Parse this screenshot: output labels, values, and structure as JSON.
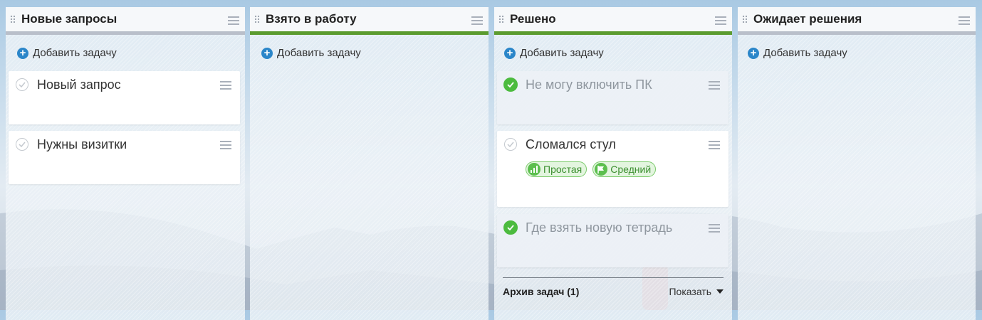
{
  "columns": [
    {
      "title": "Новые запросы",
      "add_label": "Добавить задачу",
      "bar_color": "#b9bfca",
      "cards": [
        {
          "title": "Новый запрос",
          "done": false
        },
        {
          "title": "Нужны визитки",
          "done": false
        }
      ]
    },
    {
      "title": "Взято в работу",
      "add_label": "Добавить задачу",
      "bar_color": "#5b9b2f",
      "cards": []
    },
    {
      "title": "Решено",
      "add_label": "Добавить задачу",
      "bar_color": "#5b9b2f",
      "cards": [
        {
          "title": "Не могу включить ПК",
          "done": true
        },
        {
          "title": "Сломался стул",
          "done": false,
          "tags": [
            {
              "label": "Простая",
              "icon": "bars-icon"
            },
            {
              "label": "Средний",
              "icon": "flag-icon"
            }
          ]
        },
        {
          "title": "Где взять новую тетрадь",
          "done": true
        }
      ],
      "archive": {
        "label": "Архив задач (1)",
        "show_label": "Показать"
      }
    },
    {
      "title": "Ожидает решения",
      "add_label": "Добавить задачу",
      "bar_color": "#b9bfca",
      "cards": []
    }
  ],
  "colors": {
    "accent": "#2b86c9",
    "done": "#4cbb3f",
    "tag_bg": "#e3f5df"
  }
}
